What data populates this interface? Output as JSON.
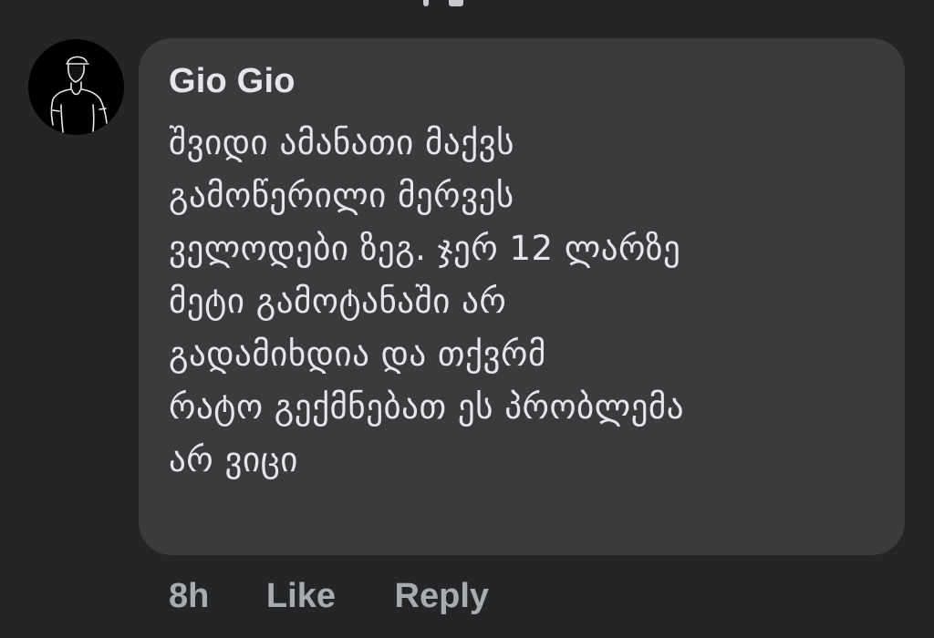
{
  "comment": {
    "author": "Gio Gio",
    "lines": [
      "შვიდი ამანათი მაქვს",
      "გამოწერილი მერვეს",
      "ველოდები ზეგ. ჯერ 12 ლარზე",
      "მეტი გამოტანაში არ",
      "გადამიხდია და თქვრმ",
      "რატო გექმნებათ ეს პრობლემა",
      "არ ვიცი"
    ],
    "timestamp": "8h",
    "like_label": "Like",
    "reply_label": "Reply"
  },
  "avatar": {
    "icon": "person-silhouette-icon"
  },
  "colors": {
    "background": "#242526",
    "bubble": "#3a3b3c",
    "text": "#e4e6eb",
    "secondary_text": "#a8abaf"
  }
}
